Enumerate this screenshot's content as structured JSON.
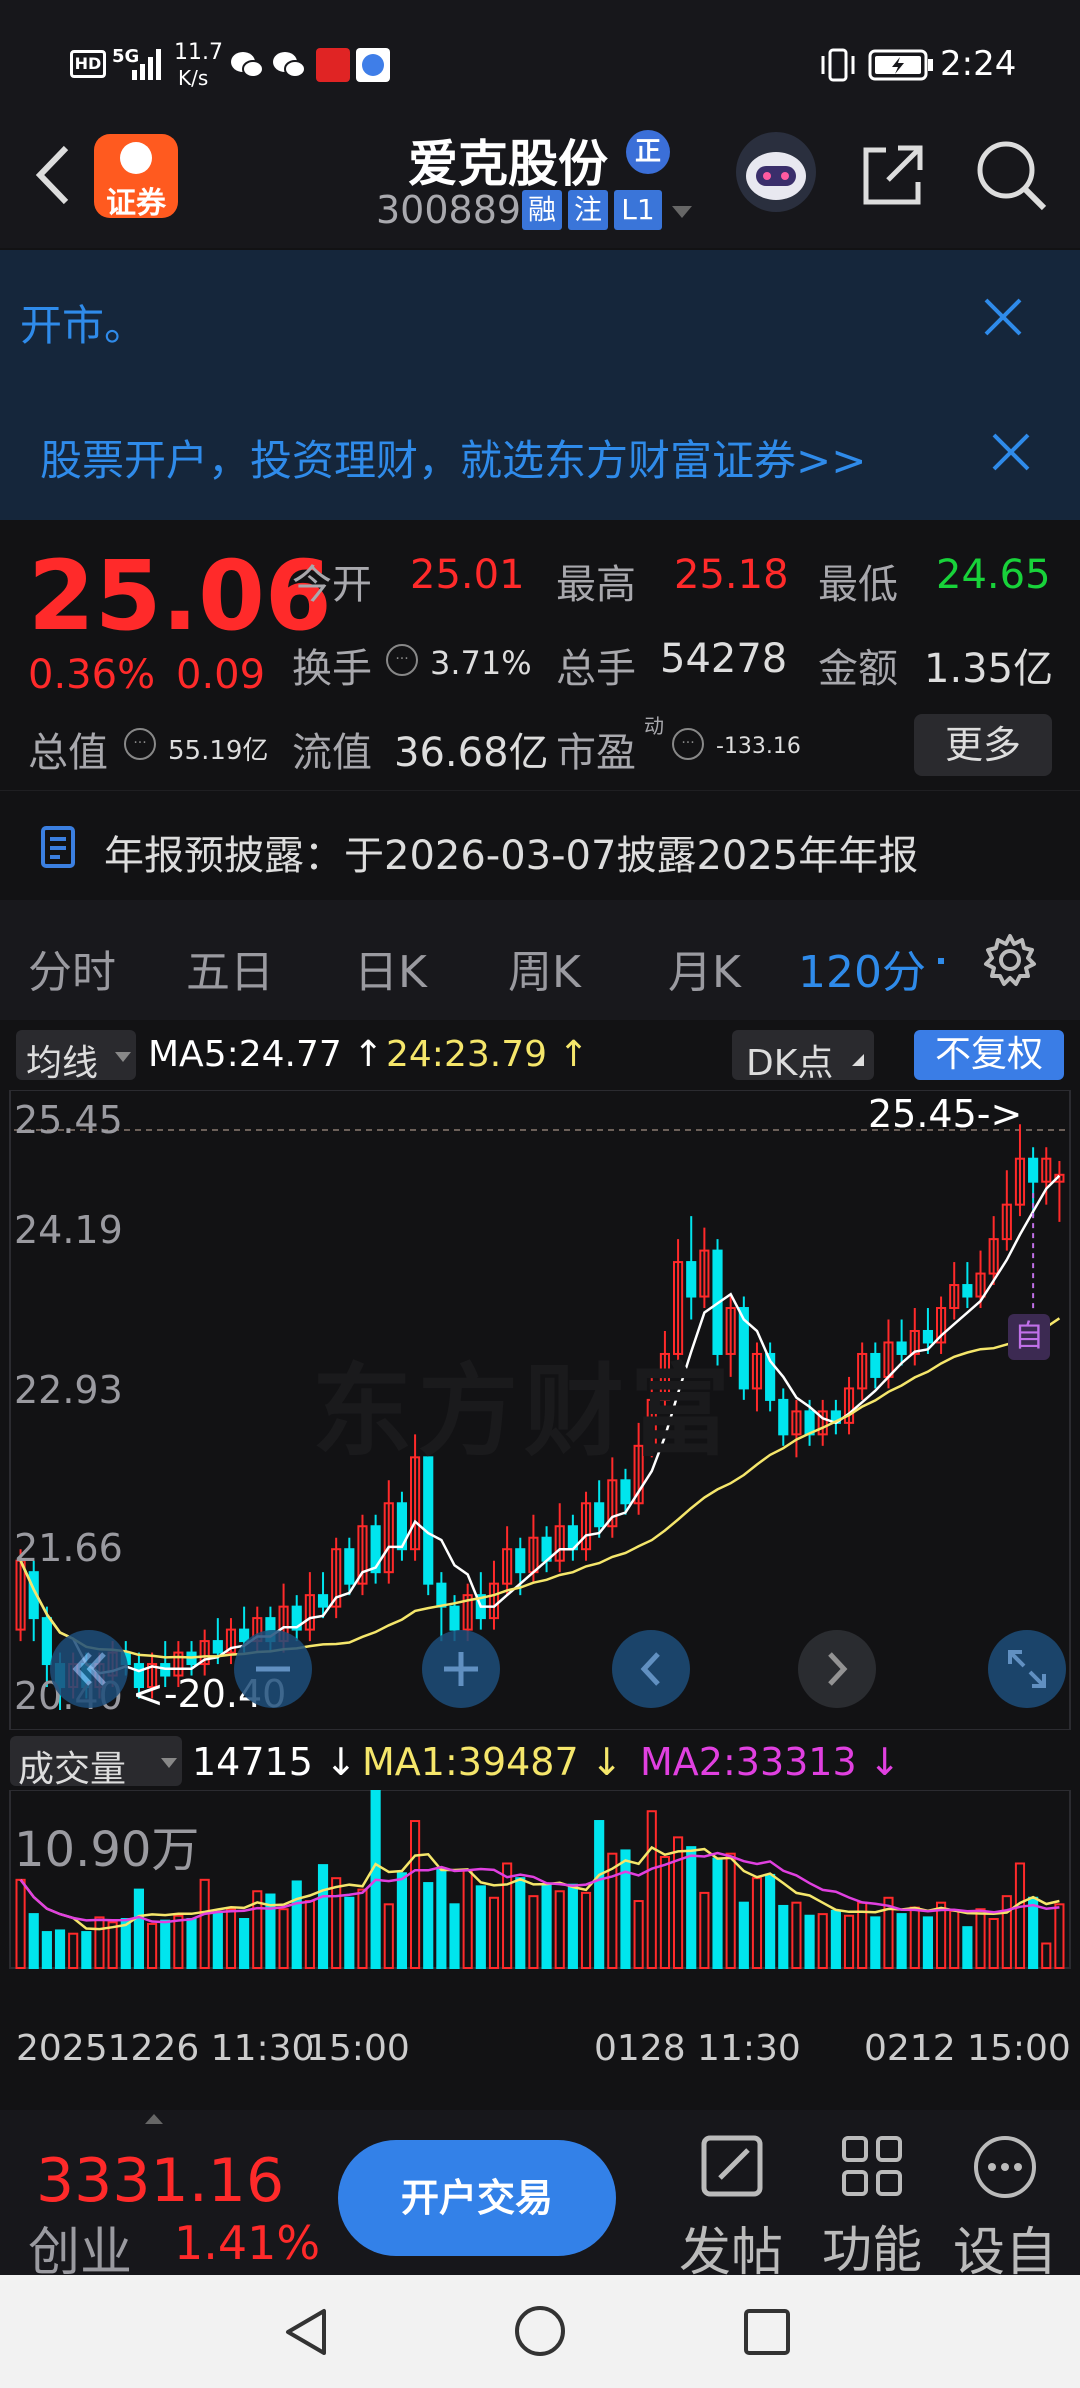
{
  "status": {
    "net_speed_value": "11.7",
    "net_speed_unit": "K/s",
    "time": "2:24",
    "signal_label": "5G"
  },
  "header": {
    "stock_name": "爱克股份",
    "badge": "正",
    "code": "300889",
    "tags": [
      "融",
      "注",
      "L1"
    ],
    "app_logo": "证券"
  },
  "notices": {
    "line1": "开市。",
    "line2": "股票开户，投资理财，就选东方财富证券>>"
  },
  "quote": {
    "price": "25.06",
    "change_pct": "0.36%",
    "change_amt": "0.09",
    "open_label": "今开",
    "open": "25.01",
    "high_label": "最高",
    "high": "25.18",
    "low_label": "最低",
    "low": "24.65",
    "turnover_label": "换手",
    "turnover": "3.71%",
    "volume_label": "总手",
    "volume": "54278",
    "amount_label": "金额",
    "amount": "1.35亿",
    "mktcap_label": "总值",
    "mktcap": "55.19亿",
    "float_label": "流值",
    "float_cap": "36.68亿",
    "pe_label": "市盈",
    "pe_sup": "动",
    "pe": "-133.16",
    "more": "更多"
  },
  "annual": {
    "text": "年报预披露：于2026-03-07披露2025年年报"
  },
  "tabs": [
    "分时",
    "五日",
    "日K",
    "周K",
    "月K",
    "120分"
  ],
  "active_tab": 5,
  "ma_line": {
    "selector": "均线",
    "ma5": "MA5:24.77",
    "ma24": "24:23.79",
    "dk": "DK点",
    "adjust": "不复权"
  },
  "kchart_labels": {
    "y": [
      "25.45",
      "24.19",
      "22.93",
      "21.66",
      "20.40"
    ],
    "high_marker": "25.45->",
    "low_marker": "<-20.40",
    "self_marker": "自",
    "watermark": "东方财富"
  },
  "vol_line": {
    "selector": "成交量",
    "vol": "14715",
    "ma1": "MA1:39487",
    "ma2": "MA2:33313"
  },
  "vol_labels": {
    "max": "10.90万"
  },
  "xaxis": [
    "20251226 11:30",
    "15:00",
    "0128 11:30",
    "0212 15:00"
  ],
  "bottom": {
    "index_value": "3331.16",
    "index_name": "创业",
    "index_change": "1.41%",
    "trade": "开户交易",
    "post": "发帖",
    "func": "功能",
    "settings": "设自"
  },
  "colors": {
    "up": "#ff2a2a",
    "down": "#00e5ee",
    "ma5": "#ffffff",
    "ma24": "#f5e66b",
    "ma2": "#e040e0",
    "accent": "#2f8bea"
  },
  "chart_data": {
    "type": "candlestick",
    "ylim": [
      20.4,
      25.45
    ],
    "candles": [
      {
        "o": 21.1,
        "c": 21.7,
        "h": 21.8,
        "l": 21.0
      },
      {
        "o": 21.6,
        "c": 21.2,
        "h": 21.7,
        "l": 21.0
      },
      {
        "o": 21.2,
        "c": 20.8,
        "h": 21.3,
        "l": 20.6
      },
      {
        "o": 20.8,
        "c": 20.6,
        "h": 20.9,
        "l": 20.4
      },
      {
        "o": 20.6,
        "c": 20.8,
        "h": 20.9,
        "l": 20.5
      },
      {
        "o": 20.8,
        "c": 20.6,
        "h": 20.9,
        "l": 20.5
      },
      {
        "o": 20.6,
        "c": 20.8,
        "h": 20.9,
        "l": 20.5
      },
      {
        "o": 20.7,
        "c": 20.9,
        "h": 21.0,
        "l": 20.6
      },
      {
        "o": 20.9,
        "c": 20.8,
        "h": 21.0,
        "l": 20.7
      },
      {
        "o": 20.8,
        "c": 20.6,
        "h": 20.9,
        "l": 20.5
      },
      {
        "o": 20.6,
        "c": 20.8,
        "h": 20.9,
        "l": 20.5
      },
      {
        "o": 20.8,
        "c": 20.7,
        "h": 21.0,
        "l": 20.6
      },
      {
        "o": 20.7,
        "c": 20.9,
        "h": 21.0,
        "l": 20.6
      },
      {
        "o": 20.9,
        "c": 20.8,
        "h": 21.0,
        "l": 20.7
      },
      {
        "o": 20.8,
        "c": 21.0,
        "h": 21.1,
        "l": 20.7
      },
      {
        "o": 21.0,
        "c": 20.9,
        "h": 21.2,
        "l": 20.8
      },
      {
        "o": 20.9,
        "c": 21.1,
        "h": 21.2,
        "l": 20.8
      },
      {
        "o": 21.1,
        "c": 21.0,
        "h": 21.3,
        "l": 20.9
      },
      {
        "o": 21.0,
        "c": 21.2,
        "h": 21.3,
        "l": 20.9
      },
      {
        "o": 21.2,
        "c": 21.0,
        "h": 21.3,
        "l": 20.9
      },
      {
        "o": 21.0,
        "c": 21.3,
        "h": 21.5,
        "l": 20.9
      },
      {
        "o": 21.3,
        "c": 21.1,
        "h": 21.4,
        "l": 21.0
      },
      {
        "o": 21.1,
        "c": 21.4,
        "h": 21.6,
        "l": 21.0
      },
      {
        "o": 21.4,
        "c": 21.3,
        "h": 21.6,
        "l": 21.2
      },
      {
        "o": 21.3,
        "c": 21.8,
        "h": 21.9,
        "l": 21.2
      },
      {
        "o": 21.8,
        "c": 21.5,
        "h": 21.9,
        "l": 21.4
      },
      {
        "o": 21.5,
        "c": 22.0,
        "h": 22.1,
        "l": 21.4
      },
      {
        "o": 22.0,
        "c": 21.6,
        "h": 22.1,
        "l": 21.5
      },
      {
        "o": 21.6,
        "c": 22.2,
        "h": 22.4,
        "l": 21.5
      },
      {
        "o": 22.2,
        "c": 21.8,
        "h": 22.3,
        "l": 21.7
      },
      {
        "o": 21.8,
        "c": 22.6,
        "h": 22.8,
        "l": 21.7
      },
      {
        "o": 22.6,
        "c": 21.5,
        "h": 22.6,
        "l": 21.4
      },
      {
        "o": 21.5,
        "c": 21.3,
        "h": 21.6,
        "l": 21.0
      },
      {
        "o": 21.3,
        "c": 21.1,
        "h": 21.4,
        "l": 21.0
      },
      {
        "o": 21.1,
        "c": 21.4,
        "h": 21.5,
        "l": 21.0
      },
      {
        "o": 21.4,
        "c": 21.2,
        "h": 21.6,
        "l": 21.1
      },
      {
        "o": 21.2,
        "c": 21.5,
        "h": 21.7,
        "l": 21.1
      },
      {
        "o": 21.5,
        "c": 21.8,
        "h": 22.0,
        "l": 21.4
      },
      {
        "o": 21.8,
        "c": 21.6,
        "h": 21.9,
        "l": 21.4
      },
      {
        "o": 21.6,
        "c": 21.9,
        "h": 22.1,
        "l": 21.5
      },
      {
        "o": 21.9,
        "c": 21.7,
        "h": 22.0,
        "l": 21.6
      },
      {
        "o": 21.7,
        "c": 22.0,
        "h": 22.2,
        "l": 21.6
      },
      {
        "o": 22.0,
        "c": 21.8,
        "h": 22.1,
        "l": 21.7
      },
      {
        "o": 21.8,
        "c": 22.2,
        "h": 22.3,
        "l": 21.7
      },
      {
        "o": 22.2,
        "c": 22.0,
        "h": 22.4,
        "l": 21.9
      },
      {
        "o": 22.0,
        "c": 22.4,
        "h": 22.6,
        "l": 21.9
      },
      {
        "o": 22.4,
        "c": 22.2,
        "h": 22.5,
        "l": 22.1
      },
      {
        "o": 22.2,
        "c": 22.7,
        "h": 22.9,
        "l": 22.1
      },
      {
        "o": 22.7,
        "c": 23.1,
        "h": 23.3,
        "l": 22.6
      },
      {
        "o": 23.1,
        "c": 23.5,
        "h": 23.7,
        "l": 23.0
      },
      {
        "o": 23.5,
        "c": 24.3,
        "h": 24.5,
        "l": 23.4
      },
      {
        "o": 24.3,
        "c": 24.0,
        "h": 24.7,
        "l": 23.8
      },
      {
        "o": 24.0,
        "c": 24.4,
        "h": 24.6,
        "l": 23.9
      },
      {
        "o": 24.4,
        "c": 23.5,
        "h": 24.5,
        "l": 23.4
      },
      {
        "o": 23.5,
        "c": 23.9,
        "h": 24.0,
        "l": 23.3
      },
      {
        "o": 23.9,
        "c": 23.2,
        "h": 24.0,
        "l": 23.1
      },
      {
        "o": 23.2,
        "c": 23.5,
        "h": 23.6,
        "l": 23.0
      },
      {
        "o": 23.5,
        "c": 23.1,
        "h": 23.6,
        "l": 23.0
      },
      {
        "o": 23.1,
        "c": 22.8,
        "h": 23.2,
        "l": 22.7
      },
      {
        "o": 22.8,
        "c": 23.0,
        "h": 23.1,
        "l": 22.6
      },
      {
        "o": 23.0,
        "c": 22.8,
        "h": 23.1,
        "l": 22.7
      },
      {
        "o": 22.8,
        "c": 23.0,
        "h": 23.1,
        "l": 22.7
      },
      {
        "o": 23.0,
        "c": 22.9,
        "h": 23.1,
        "l": 22.8
      },
      {
        "o": 22.9,
        "c": 23.2,
        "h": 23.3,
        "l": 22.8
      },
      {
        "o": 23.2,
        "c": 23.5,
        "h": 23.6,
        "l": 23.1
      },
      {
        "o": 23.5,
        "c": 23.3,
        "h": 23.6,
        "l": 23.2
      },
      {
        "o": 23.3,
        "c": 23.6,
        "h": 23.8,
        "l": 23.2
      },
      {
        "o": 23.6,
        "c": 23.5,
        "h": 23.8,
        "l": 23.4
      },
      {
        "o": 23.5,
        "c": 23.7,
        "h": 23.9,
        "l": 23.4
      },
      {
        "o": 23.7,
        "c": 23.6,
        "h": 23.9,
        "l": 23.5
      },
      {
        "o": 23.6,
        "c": 23.9,
        "h": 24.0,
        "l": 23.5
      },
      {
        "o": 23.9,
        "c": 24.1,
        "h": 24.3,
        "l": 23.8
      },
      {
        "o": 24.1,
        "c": 24.0,
        "h": 24.3,
        "l": 23.9
      },
      {
        "o": 24.0,
        "c": 24.2,
        "h": 24.4,
        "l": 23.9
      },
      {
        "o": 24.2,
        "c": 24.5,
        "h": 24.7,
        "l": 24.1
      },
      {
        "o": 24.5,
        "c": 24.8,
        "h": 25.1,
        "l": 24.4
      },
      {
        "o": 24.8,
        "c": 25.2,
        "h": 25.5,
        "l": 24.7
      },
      {
        "o": 25.2,
        "c": 25.0,
        "h": 25.3,
        "l": 24.7
      },
      {
        "o": 25.0,
        "c": 25.2,
        "h": 25.3,
        "l": 24.8
      },
      {
        "o": 25.0,
        "c": 25.06,
        "h": 25.18,
        "l": 24.65
      }
    ],
    "volumes": [
      5.4,
      3.3,
      2.2,
      2.3,
      2.1,
      2.2,
      3.1,
      2.8,
      3.0,
      4.8,
      2.7,
      2.9,
      3.2,
      3.0,
      5.4,
      3.4,
      3.6,
      3.0,
      4.7,
      4.5,
      3.6,
      5.3,
      4.1,
      6.3,
      5.5,
      4.3,
      4.8,
      10.9,
      3.9,
      5.8,
      9.0,
      5.2,
      6.1,
      3.9,
      6.0,
      5.0,
      4.3,
      6.4,
      5.5,
      4.4,
      5.1,
      4.7,
      5.1,
      4.6,
      9.0,
      7.0,
      7.2,
      4.1,
      9.6,
      6.8,
      8.0,
      7.4,
      4.6,
      6.7,
      7.0,
      4.0,
      5.5,
      5.7,
      3.8,
      4.0,
      3.2,
      3.3,
      3.5,
      3.2,
      4.0,
      3.1,
      4.3,
      3.3,
      3.7,
      3.1,
      4.0,
      3.5,
      2.5,
      3.6,
      3.0,
      4.4,
      6.4,
      4.3,
      1.5,
      3.9
    ]
  }
}
